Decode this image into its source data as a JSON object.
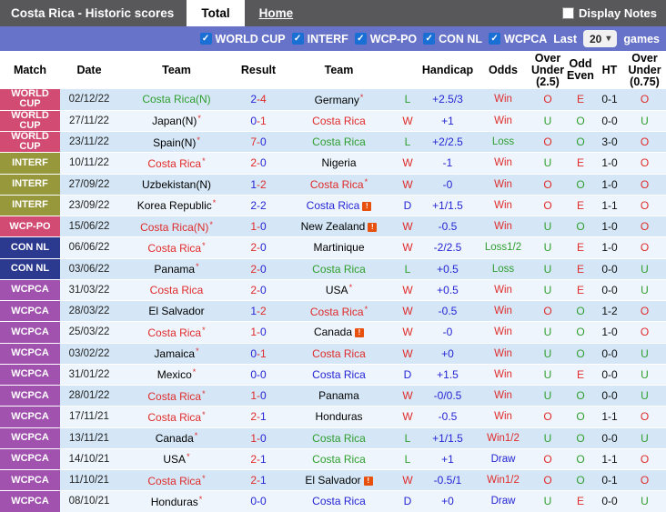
{
  "titlebar": {
    "title": "Costa Rica - Historic scores",
    "tabs": [
      {
        "label": "Total",
        "active": true
      },
      {
        "label": "Home",
        "active": false
      }
    ],
    "display_notes": {
      "label": "Display Notes",
      "checked": false
    }
  },
  "filterbar": {
    "filters": [
      {
        "label": "WORLD CUP",
        "checked": true
      },
      {
        "label": "INTERF",
        "checked": true
      },
      {
        "label": "WCP-PO",
        "checked": true
      },
      {
        "label": "CON NL",
        "checked": true
      },
      {
        "label": "WCPCA",
        "checked": true
      }
    ],
    "last_label": "Last",
    "last_value": "20",
    "games_label": "games"
  },
  "icons": {
    "check_icon": "✓",
    "chevron_down_icon": "▾",
    "note_icon": "!"
  },
  "colors": {
    "red": "#e02b2b",
    "green": "#2f9e2f",
    "blue": "#2525d5",
    "black": "#000000",
    "comp_pink": "#d24b72",
    "comp_olive": "#97983b",
    "comp_navy": "#2b3a8e",
    "comp_purple": "#a052ae",
    "bar_blue": "#6673c8",
    "titlebar_gray": "#58585a",
    "row_odd": "#d5e7f6",
    "row_even": "#eef5fc"
  },
  "table": {
    "headers": [
      "Match",
      "Date",
      "Team",
      "Result",
      "Team",
      "",
      "Handicap",
      "Odds",
      "Over\nUnder\n(2.5)",
      "Odd\nEven",
      "HT",
      "Over\nUnder\n(0.75)"
    ],
    "rows": [
      {
        "comp": "WORLD CUP",
        "cc": "pink",
        "date": "02/12/22",
        "home": {
          "n": "Costa Rica(N)",
          "c": "green",
          "star": false,
          "badge": false
        },
        "score": {
          "h": "2",
          "hc": "blue",
          "dc": "red",
          "a": "4",
          "ac": "red"
        },
        "away": {
          "n": "Germany",
          "c": "black",
          "star": true,
          "badge": false
        },
        "wdl": {
          "t": "L",
          "c": "green"
        },
        "hcp": "+2.5/3",
        "odds": {
          "t": "Win",
          "c": "red"
        },
        "ou25": {
          "t": "O",
          "c": "red"
        },
        "oe": {
          "t": "E",
          "c": "red"
        },
        "ht": "0-1",
        "ou075": {
          "t": "O",
          "c": "red"
        }
      },
      {
        "comp": "WORLD CUP",
        "cc": "pink",
        "date": "27/11/22",
        "home": {
          "n": "Japan(N)",
          "c": "black",
          "star": true,
          "badge": false
        },
        "score": {
          "h": "0",
          "hc": "blue",
          "dc": "red",
          "a": "1",
          "ac": "red"
        },
        "away": {
          "n": "Costa Rica",
          "c": "red",
          "star": false,
          "badge": false
        },
        "wdl": {
          "t": "W",
          "c": "red"
        },
        "hcp": "+1",
        "odds": {
          "t": "Win",
          "c": "red"
        },
        "ou25": {
          "t": "U",
          "c": "green"
        },
        "oe": {
          "t": "O",
          "c": "green"
        },
        "ht": "0-0",
        "ou075": {
          "t": "U",
          "c": "green"
        }
      },
      {
        "comp": "WORLD CUP",
        "cc": "pink",
        "date": "23/11/22",
        "home": {
          "n": "Spain(N)",
          "c": "black",
          "star": true,
          "badge": false
        },
        "score": {
          "h": "7",
          "hc": "red",
          "dc": "red",
          "a": "0",
          "ac": "blue"
        },
        "away": {
          "n": "Costa Rica",
          "c": "green",
          "star": false,
          "badge": false
        },
        "wdl": {
          "t": "L",
          "c": "green"
        },
        "hcp": "+2/2.5",
        "odds": {
          "t": "Loss",
          "c": "green"
        },
        "ou25": {
          "t": "O",
          "c": "red"
        },
        "oe": {
          "t": "O",
          "c": "green"
        },
        "ht": "3-0",
        "ou075": {
          "t": "O",
          "c": "red"
        }
      },
      {
        "comp": "INTERF",
        "cc": "olive",
        "date": "10/11/22",
        "home": {
          "n": "Costa Rica",
          "c": "red",
          "star": true,
          "badge": false
        },
        "score": {
          "h": "2",
          "hc": "red",
          "dc": "red",
          "a": "0",
          "ac": "blue"
        },
        "away": {
          "n": "Nigeria",
          "c": "black",
          "star": false,
          "badge": false
        },
        "wdl": {
          "t": "W",
          "c": "red"
        },
        "hcp": "-1",
        "odds": {
          "t": "Win",
          "c": "red"
        },
        "ou25": {
          "t": "U",
          "c": "green"
        },
        "oe": {
          "t": "E",
          "c": "red"
        },
        "ht": "1-0",
        "ou075": {
          "t": "O",
          "c": "red"
        }
      },
      {
        "comp": "INTERF",
        "cc": "olive",
        "date": "27/09/22",
        "home": {
          "n": "Uzbekistan(N)",
          "c": "black",
          "star": false,
          "badge": false
        },
        "score": {
          "h": "1",
          "hc": "blue",
          "dc": "red",
          "a": "2",
          "ac": "red"
        },
        "away": {
          "n": "Costa Rica",
          "c": "red",
          "star": true,
          "badge": false
        },
        "wdl": {
          "t": "W",
          "c": "red"
        },
        "hcp": "-0",
        "odds": {
          "t": "Win",
          "c": "red"
        },
        "ou25": {
          "t": "O",
          "c": "red"
        },
        "oe": {
          "t": "O",
          "c": "green"
        },
        "ht": "1-0",
        "ou075": {
          "t": "O",
          "c": "red"
        }
      },
      {
        "comp": "INTERF",
        "cc": "olive",
        "date": "23/09/22",
        "home": {
          "n": "Korea Republic",
          "c": "black",
          "star": true,
          "badge": false
        },
        "score": {
          "h": "2",
          "hc": "blue",
          "dc": "blue",
          "a": "2",
          "ac": "blue"
        },
        "away": {
          "n": "Costa Rica",
          "c": "blue",
          "star": false,
          "badge": true
        },
        "wdl": {
          "t": "D",
          "c": "blue"
        },
        "hcp": "+1/1.5",
        "odds": {
          "t": "Win",
          "c": "red"
        },
        "ou25": {
          "t": "O",
          "c": "red"
        },
        "oe": {
          "t": "E",
          "c": "red"
        },
        "ht": "1-1",
        "ou075": {
          "t": "O",
          "c": "red"
        }
      },
      {
        "comp": "WCP-PO",
        "cc": "pink",
        "date": "15/06/22",
        "home": {
          "n": "Costa Rica(N)",
          "c": "red",
          "star": true,
          "badge": false
        },
        "score": {
          "h": "1",
          "hc": "red",
          "dc": "red",
          "a": "0",
          "ac": "blue"
        },
        "away": {
          "n": "New Zealand",
          "c": "black",
          "star": false,
          "badge": true
        },
        "wdl": {
          "t": "W",
          "c": "red"
        },
        "hcp": "-0.5",
        "odds": {
          "t": "Win",
          "c": "red"
        },
        "ou25": {
          "t": "U",
          "c": "green"
        },
        "oe": {
          "t": "O",
          "c": "green"
        },
        "ht": "1-0",
        "ou075": {
          "t": "O",
          "c": "red"
        }
      },
      {
        "comp": "CON NL",
        "cc": "navy",
        "date": "06/06/22",
        "home": {
          "n": "Costa Rica",
          "c": "red",
          "star": true,
          "badge": false
        },
        "score": {
          "h": "2",
          "hc": "red",
          "dc": "red",
          "a": "0",
          "ac": "blue"
        },
        "away": {
          "n": "Martinique",
          "c": "black",
          "star": false,
          "badge": false
        },
        "wdl": {
          "t": "W",
          "c": "red"
        },
        "hcp": "-2/2.5",
        "odds": {
          "t": "Loss1/2",
          "c": "green"
        },
        "ou25": {
          "t": "U",
          "c": "green"
        },
        "oe": {
          "t": "E",
          "c": "red"
        },
        "ht": "1-0",
        "ou075": {
          "t": "O",
          "c": "red"
        }
      },
      {
        "comp": "CON NL",
        "cc": "navy",
        "date": "03/06/22",
        "home": {
          "n": "Panama",
          "c": "black",
          "star": true,
          "badge": false
        },
        "score": {
          "h": "2",
          "hc": "red",
          "dc": "red",
          "a": "0",
          "ac": "blue"
        },
        "away": {
          "n": "Costa Rica",
          "c": "green",
          "star": false,
          "badge": false
        },
        "wdl": {
          "t": "L",
          "c": "green"
        },
        "hcp": "+0.5",
        "odds": {
          "t": "Loss",
          "c": "green"
        },
        "ou25": {
          "t": "U",
          "c": "green"
        },
        "oe": {
          "t": "E",
          "c": "red"
        },
        "ht": "0-0",
        "ou075": {
          "t": "U",
          "c": "green"
        }
      },
      {
        "comp": "WCPCA",
        "cc": "purple",
        "date": "31/03/22",
        "home": {
          "n": "Costa Rica",
          "c": "red",
          "star": false,
          "badge": false
        },
        "score": {
          "h": "2",
          "hc": "red",
          "dc": "red",
          "a": "0",
          "ac": "blue"
        },
        "away": {
          "n": "USA",
          "c": "black",
          "star": true,
          "badge": false
        },
        "wdl": {
          "t": "W",
          "c": "red"
        },
        "hcp": "+0.5",
        "odds": {
          "t": "Win",
          "c": "red"
        },
        "ou25": {
          "t": "U",
          "c": "green"
        },
        "oe": {
          "t": "E",
          "c": "red"
        },
        "ht": "0-0",
        "ou075": {
          "t": "U",
          "c": "green"
        }
      },
      {
        "comp": "WCPCA",
        "cc": "purple",
        "date": "28/03/22",
        "home": {
          "n": "El Salvador",
          "c": "black",
          "star": false,
          "badge": false
        },
        "score": {
          "h": "1",
          "hc": "blue",
          "dc": "red",
          "a": "2",
          "ac": "red"
        },
        "away": {
          "n": "Costa Rica",
          "c": "red",
          "star": true,
          "badge": false
        },
        "wdl": {
          "t": "W",
          "c": "red"
        },
        "hcp": "-0.5",
        "odds": {
          "t": "Win",
          "c": "red"
        },
        "ou25": {
          "t": "O",
          "c": "red"
        },
        "oe": {
          "t": "O",
          "c": "green"
        },
        "ht": "1-2",
        "ou075": {
          "t": "O",
          "c": "red"
        }
      },
      {
        "comp": "WCPCA",
        "cc": "purple",
        "date": "25/03/22",
        "home": {
          "n": "Costa Rica",
          "c": "red",
          "star": true,
          "badge": false
        },
        "score": {
          "h": "1",
          "hc": "red",
          "dc": "red",
          "a": "0",
          "ac": "blue"
        },
        "away": {
          "n": "Canada",
          "c": "black",
          "star": false,
          "badge": true
        },
        "wdl": {
          "t": "W",
          "c": "red"
        },
        "hcp": "-0",
        "odds": {
          "t": "Win",
          "c": "red"
        },
        "ou25": {
          "t": "U",
          "c": "green"
        },
        "oe": {
          "t": "O",
          "c": "green"
        },
        "ht": "1-0",
        "ou075": {
          "t": "O",
          "c": "red"
        }
      },
      {
        "comp": "WCPCA",
        "cc": "purple",
        "date": "03/02/22",
        "home": {
          "n": "Jamaica",
          "c": "black",
          "star": true,
          "badge": false
        },
        "score": {
          "h": "0",
          "hc": "blue",
          "dc": "red",
          "a": "1",
          "ac": "red"
        },
        "away": {
          "n": "Costa Rica",
          "c": "red",
          "star": false,
          "badge": false
        },
        "wdl": {
          "t": "W",
          "c": "red"
        },
        "hcp": "+0",
        "odds": {
          "t": "Win",
          "c": "red"
        },
        "ou25": {
          "t": "U",
          "c": "green"
        },
        "oe": {
          "t": "O",
          "c": "green"
        },
        "ht": "0-0",
        "ou075": {
          "t": "U",
          "c": "green"
        }
      },
      {
        "comp": "WCPCA",
        "cc": "purple",
        "date": "31/01/22",
        "home": {
          "n": "Mexico",
          "c": "black",
          "star": true,
          "badge": false
        },
        "score": {
          "h": "0",
          "hc": "blue",
          "dc": "blue",
          "a": "0",
          "ac": "blue"
        },
        "away": {
          "n": "Costa Rica",
          "c": "blue",
          "star": false,
          "badge": false
        },
        "wdl": {
          "t": "D",
          "c": "blue"
        },
        "hcp": "+1.5",
        "odds": {
          "t": "Win",
          "c": "red"
        },
        "ou25": {
          "t": "U",
          "c": "green"
        },
        "oe": {
          "t": "E",
          "c": "red"
        },
        "ht": "0-0",
        "ou075": {
          "t": "U",
          "c": "green"
        }
      },
      {
        "comp": "WCPCA",
        "cc": "purple",
        "date": "28/01/22",
        "home": {
          "n": "Costa Rica",
          "c": "red",
          "star": true,
          "badge": false
        },
        "score": {
          "h": "1",
          "hc": "red",
          "dc": "red",
          "a": "0",
          "ac": "blue"
        },
        "away": {
          "n": "Panama",
          "c": "black",
          "star": false,
          "badge": false
        },
        "wdl": {
          "t": "W",
          "c": "red"
        },
        "hcp": "-0/0.5",
        "odds": {
          "t": "Win",
          "c": "red"
        },
        "ou25": {
          "t": "U",
          "c": "green"
        },
        "oe": {
          "t": "O",
          "c": "green"
        },
        "ht": "0-0",
        "ou075": {
          "t": "U",
          "c": "green"
        }
      },
      {
        "comp": "WCPCA",
        "cc": "purple",
        "date": "17/11/21",
        "home": {
          "n": "Costa Rica",
          "c": "red",
          "star": true,
          "badge": false
        },
        "score": {
          "h": "2",
          "hc": "red",
          "dc": "red",
          "a": "1",
          "ac": "blue"
        },
        "away": {
          "n": "Honduras",
          "c": "black",
          "star": false,
          "badge": false
        },
        "wdl": {
          "t": "W",
          "c": "red"
        },
        "hcp": "-0.5",
        "odds": {
          "t": "Win",
          "c": "red"
        },
        "ou25": {
          "t": "O",
          "c": "red"
        },
        "oe": {
          "t": "O",
          "c": "green"
        },
        "ht": "1-1",
        "ou075": {
          "t": "O",
          "c": "red"
        }
      },
      {
        "comp": "WCPCA",
        "cc": "purple",
        "date": "13/11/21",
        "home": {
          "n": "Canada",
          "c": "black",
          "star": true,
          "badge": false
        },
        "score": {
          "h": "1",
          "hc": "red",
          "dc": "red",
          "a": "0",
          "ac": "blue"
        },
        "away": {
          "n": "Costa Rica",
          "c": "green",
          "star": false,
          "badge": false
        },
        "wdl": {
          "t": "L",
          "c": "green"
        },
        "hcp": "+1/1.5",
        "odds": {
          "t": "Win1/2",
          "c": "red"
        },
        "ou25": {
          "t": "U",
          "c": "green"
        },
        "oe": {
          "t": "O",
          "c": "green"
        },
        "ht": "0-0",
        "ou075": {
          "t": "U",
          "c": "green"
        }
      },
      {
        "comp": "WCPCA",
        "cc": "purple",
        "date": "14/10/21",
        "home": {
          "n": "USA",
          "c": "black",
          "star": true,
          "badge": false
        },
        "score": {
          "h": "2",
          "hc": "red",
          "dc": "red",
          "a": "1",
          "ac": "blue"
        },
        "away": {
          "n": "Costa Rica",
          "c": "green",
          "star": false,
          "badge": false
        },
        "wdl": {
          "t": "L",
          "c": "green"
        },
        "hcp": "+1",
        "odds": {
          "t": "Draw",
          "c": "blue"
        },
        "ou25": {
          "t": "O",
          "c": "red"
        },
        "oe": {
          "t": "O",
          "c": "green"
        },
        "ht": "1-1",
        "ou075": {
          "t": "O",
          "c": "red"
        }
      },
      {
        "comp": "WCPCA",
        "cc": "purple",
        "date": "11/10/21",
        "home": {
          "n": "Costa Rica",
          "c": "red",
          "star": true,
          "badge": false
        },
        "score": {
          "h": "2",
          "hc": "red",
          "dc": "red",
          "a": "1",
          "ac": "blue"
        },
        "away": {
          "n": "El Salvador",
          "c": "black",
          "star": false,
          "badge": true
        },
        "wdl": {
          "t": "W",
          "c": "red"
        },
        "hcp": "-0.5/1",
        "odds": {
          "t": "Win1/2",
          "c": "red"
        },
        "ou25": {
          "t": "O",
          "c": "red"
        },
        "oe": {
          "t": "O",
          "c": "green"
        },
        "ht": "0-1",
        "ou075": {
          "t": "O",
          "c": "red"
        }
      },
      {
        "comp": "WCPCA",
        "cc": "purple",
        "date": "08/10/21",
        "home": {
          "n": "Honduras",
          "c": "black",
          "star": true,
          "badge": false
        },
        "score": {
          "h": "0",
          "hc": "blue",
          "dc": "blue",
          "a": "0",
          "ac": "blue"
        },
        "away": {
          "n": "Costa Rica",
          "c": "blue",
          "star": false,
          "badge": false
        },
        "wdl": {
          "t": "D",
          "c": "blue"
        },
        "hcp": "+0",
        "odds": {
          "t": "Draw",
          "c": "blue"
        },
        "ou25": {
          "t": "U",
          "c": "green"
        },
        "oe": {
          "t": "E",
          "c": "red"
        },
        "ht": "0-0",
        "ou075": {
          "t": "U",
          "c": "green"
        }
      }
    ]
  }
}
